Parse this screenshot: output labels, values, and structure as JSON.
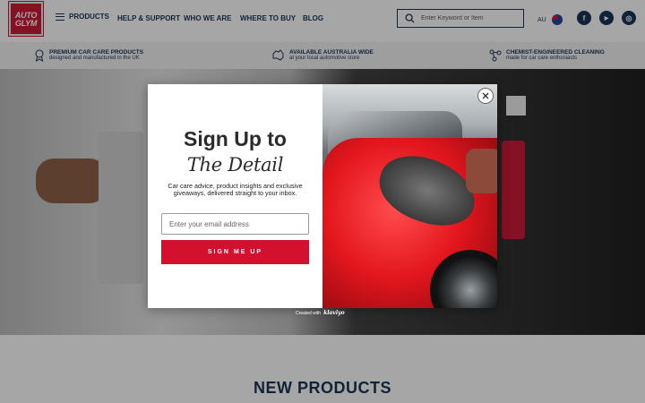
{
  "header": {
    "logo_text": "AUTO GLYM",
    "menu_label": "PRODUCTS",
    "nav": [
      "HELP & SUPPORT",
      "WHO WE ARE",
      "WHERE TO BUY",
      "BLOG"
    ],
    "search_placeholder": "Enter Keyword or Item",
    "region": "AU",
    "social": [
      "f",
      "▶",
      "◎"
    ]
  },
  "usp": [
    {
      "title": "PREMIUM CAR CARE PRODUCTS",
      "sub": "designed and manufactured in the UK",
      "icon": "award-icon"
    },
    {
      "title": "AVAILABLE AUSTRALIA WIDE",
      "sub": "at your local automotive store",
      "icon": "australia-map-icon"
    },
    {
      "title": "CHEMIST-ENGINEERED CLEANING",
      "sub": "made for car care enthusiasts",
      "icon": "molecule-icon"
    }
  ],
  "section": {
    "title": "NEW PRODUCTS"
  },
  "modal": {
    "title": "Sign Up to",
    "subtitle": "The Detail",
    "description": "Car care advice, product insights and exclusive giveaways, delivered straight to your inbox.",
    "email_placeholder": "Enter your email address",
    "button_label": "SIGN ME UP",
    "credit_prefix": "Created with",
    "credit_brand": "klaviyo"
  },
  "colors": {
    "brand_red": "#d4102f",
    "navy": "#102b4e"
  }
}
